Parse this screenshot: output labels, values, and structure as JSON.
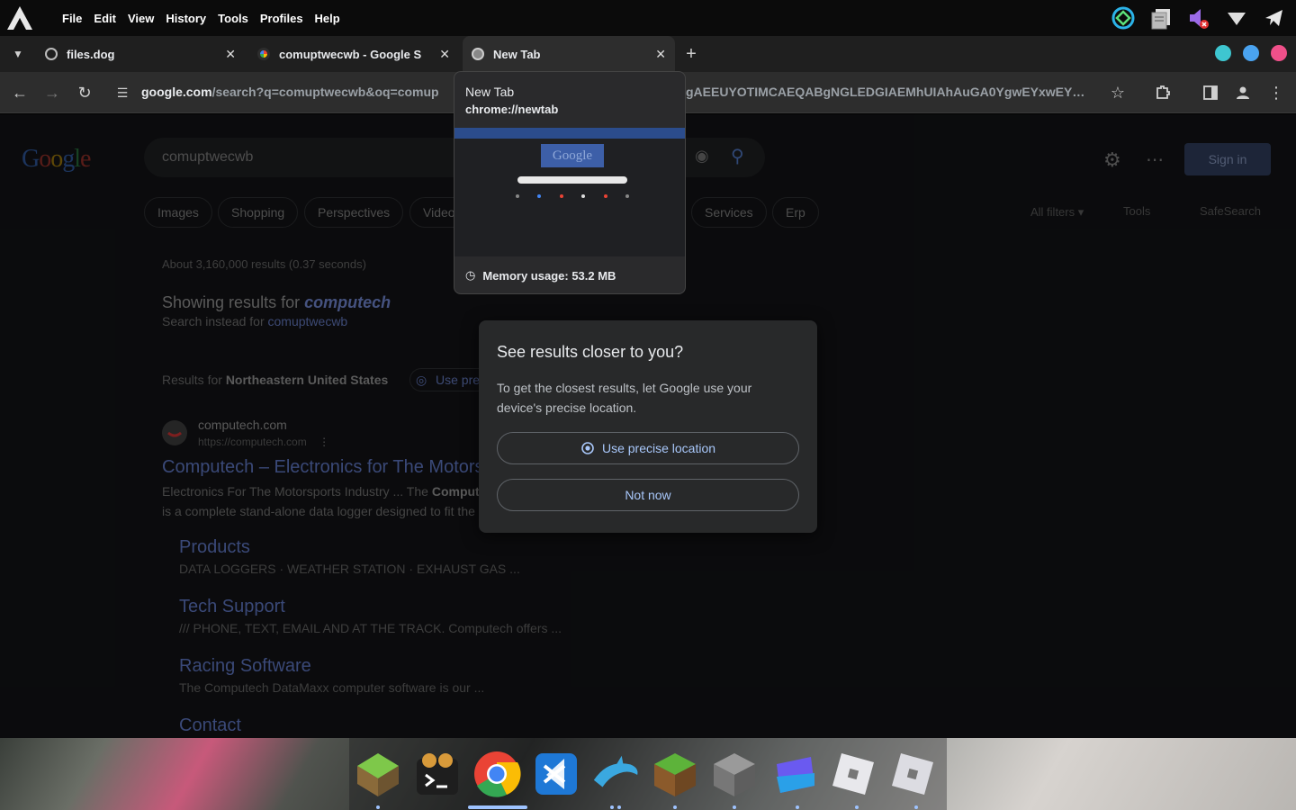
{
  "menubar": {
    "items": [
      "File",
      "Edit",
      "View",
      "History",
      "Tools",
      "Profiles",
      "Help"
    ]
  },
  "tabs": [
    {
      "title": "files.dog"
    },
    {
      "title": "comuptwecwb - Google S"
    },
    {
      "title": "New Tab"
    }
  ],
  "toolbar": {
    "url_host": "google.com",
    "url_path": "/search?q=comuptwecwb&oq=comup",
    "url_tail": "gAEEUYOTIMCAEQABgNGLEDGIAEMhUIAhAuGA0YgwEYxwEY…"
  },
  "google": {
    "logo": "Google",
    "query": "comuptwecwb",
    "sign_in": "Sign in",
    "chips": [
      "Images",
      "Shopping",
      "Perspectives",
      "Video",
      "Services",
      "Erp"
    ],
    "all_filters": "All filters",
    "tools": "Tools",
    "safesearch": "SafeSearch",
    "stats": "About 3,160,000 results (0.37 seconds)",
    "showing_prefix": "Showing results for ",
    "showing_term": "computech",
    "instead_prefix": "Search instead for ",
    "instead_term": "comuptwecwb",
    "region_prefix": "Results for ",
    "region_name": "Northeastern United States",
    "use_precise_chip": "Use pre",
    "result": {
      "site_name": "computech.com",
      "site_url": "https://computech.com",
      "title": "Computech – Electronics for The Motors",
      "snippet1_a": "Electronics For The Motorsports Industry ... The ",
      "snippet1_b": "Comput",
      "snippet2": "is a complete stand-alone data logger designed to fit the",
      "sublinks": [
        {
          "title": "Products",
          "desc": "DATA LOGGERS · WEATHER STATION · EXHAUST GAS ..."
        },
        {
          "title": "Tech Support",
          "desc": "/// PHONE, TEXT, EMAIL AND AT THE TRACK. Computech offers ..."
        },
        {
          "title": "Racing Software",
          "desc": "The Computech DataMaxx computer software is our ..."
        },
        {
          "title": "Contact",
          "desc": ""
        }
      ]
    }
  },
  "hovercard": {
    "title": "New Tab",
    "url": "chrome://newtab",
    "thumb_logo": "Google",
    "memory": "Memory usage: 53.2 MB"
  },
  "dialog": {
    "title": "See results closer to you?",
    "body": "To get the closest results, let Google use your device's precise location.",
    "primary": "Use precise location",
    "secondary": "Not now"
  },
  "colors": {
    "accent": "#a8c7fa",
    "dot1": "#3ec6d0",
    "dot2": "#4aa3f0",
    "dot3": "#f0508a"
  }
}
